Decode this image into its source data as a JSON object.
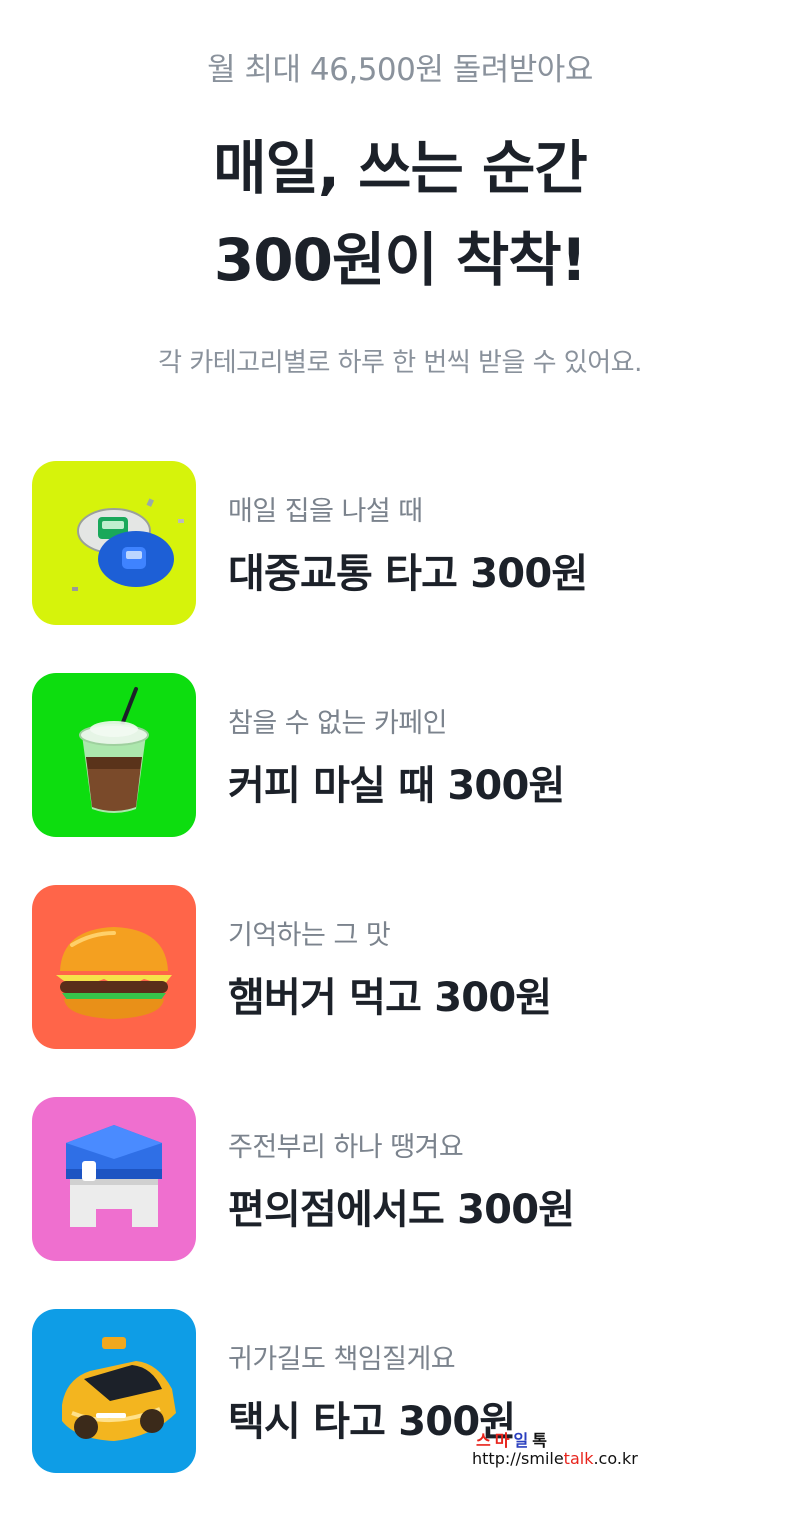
{
  "header": {
    "subtitle": "월 최대 46,500원 돌려받아요",
    "headline_line1": "매일, 쓰는 순간",
    "headline_line2": "300원이 착착!",
    "description": "각 카테고리별로 하루 한 번씩 받을 수 있어요."
  },
  "benefits": [
    {
      "caption": "매일 집을 나설 때",
      "title": "대중교통 타고 300원",
      "icon": "transit-icon",
      "tile_color": "#d6f30b"
    },
    {
      "caption": "참을 수 없는 카페인",
      "title": "커피 마실 때 300원",
      "icon": "iced-coffee-icon",
      "tile_color": "#0ddd0f"
    },
    {
      "caption": "기억하는 그 맛",
      "title": "햄버거 먹고 300원",
      "icon": "hamburger-icon",
      "tile_color": "#ff6549"
    },
    {
      "caption": "주전부리 하나 땡겨요",
      "title": "편의점에서도 300원",
      "icon": "convenience-store-icon",
      "tile_color": "#ef6fcf"
    },
    {
      "caption": "귀가길도 책임질게요",
      "title": "택시 타고 300원",
      "icon": "taxi-icon",
      "tile_color": "#0e9de6"
    }
  ],
  "watermark": {
    "brand_chars": [
      "스",
      "마",
      "일",
      "톡"
    ],
    "brand_colors": [
      "#e8241c",
      "#e8241c",
      "#2a3fbf",
      "#111111"
    ],
    "url_prefix": "http://smile",
    "url_accent": "talk",
    "url_suffix": ".co.kr"
  }
}
